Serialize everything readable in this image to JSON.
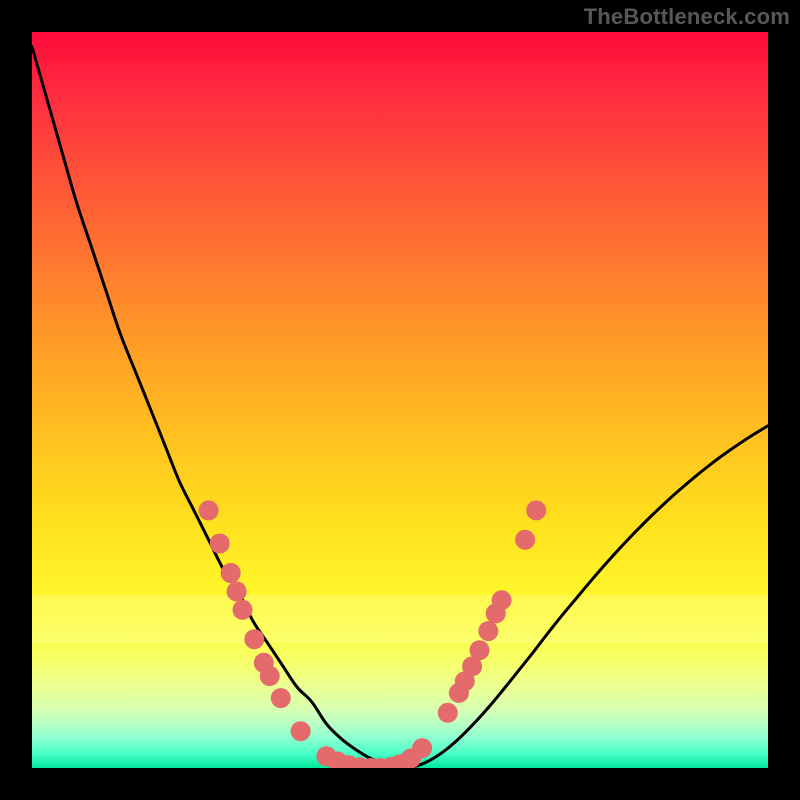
{
  "watermark": {
    "text": "TheBottleneck.com"
  },
  "colors": {
    "line": "#000000",
    "dot": "#e46a6c",
    "dot_stroke": "#d25a5c"
  },
  "chart_data": {
    "type": "line",
    "title": "",
    "xlabel": "",
    "ylabel": "",
    "xlim": [
      0,
      100
    ],
    "ylim": [
      0,
      100
    ],
    "grid": false,
    "legend": false,
    "series": [
      {
        "name": "bottleneck-curve",
        "x": [
          0,
          2,
          4,
          6,
          8,
          10,
          12,
          14,
          16,
          18,
          20,
          22,
          24,
          26,
          28,
          30,
          32,
          34,
          36,
          38,
          40,
          42,
          44,
          46,
          48,
          50,
          52,
          54,
          56,
          58,
          60,
          62,
          64,
          66,
          68,
          70,
          72,
          74,
          76,
          78,
          80,
          82,
          84,
          86,
          88,
          90,
          92,
          94,
          96,
          98,
          100
        ],
        "y": [
          98,
          91,
          84,
          77,
          71,
          65,
          59,
          54,
          49,
          44,
          39,
          35,
          31,
          27,
          24,
          20,
          17,
          14,
          11,
          9,
          6,
          4,
          2.5,
          1.3,
          0.5,
          0,
          0.2,
          1.0,
          2.3,
          4.0,
          6.0,
          8.2,
          10.6,
          13.1,
          15.6,
          18.2,
          20.7,
          23.1,
          25.5,
          27.8,
          30.0,
          32.1,
          34.1,
          36.0,
          37.8,
          39.5,
          41.1,
          42.6,
          44.0,
          45.3,
          46.5
        ]
      }
    ],
    "markers": [
      {
        "x": 24,
        "y": 35
      },
      {
        "x": 25.5,
        "y": 30.5
      },
      {
        "x": 27,
        "y": 26.5
      },
      {
        "x": 27.8,
        "y": 24
      },
      {
        "x": 28.6,
        "y": 21.5
      },
      {
        "x": 30.2,
        "y": 17.5
      },
      {
        "x": 31.5,
        "y": 14.3
      },
      {
        "x": 32.3,
        "y": 12.5
      },
      {
        "x": 33.8,
        "y": 9.5
      },
      {
        "x": 36.5,
        "y": 5
      },
      {
        "x": 40,
        "y": 1.6
      },
      {
        "x": 41.5,
        "y": 0.9
      },
      {
        "x": 43,
        "y": 0.4
      },
      {
        "x": 44.5,
        "y": 0.1
      },
      {
        "x": 46,
        "y": 0
      },
      {
        "x": 47.3,
        "y": 0
      },
      {
        "x": 48.8,
        "y": 0.15
      },
      {
        "x": 50,
        "y": 0.5
      },
      {
        "x": 51.5,
        "y": 1.3
      },
      {
        "x": 53,
        "y": 2.7
      },
      {
        "x": 56.5,
        "y": 7.5
      },
      {
        "x": 58,
        "y": 10.2
      },
      {
        "x": 58.8,
        "y": 11.8
      },
      {
        "x": 59.8,
        "y": 13.8
      },
      {
        "x": 60.8,
        "y": 16
      },
      {
        "x": 62,
        "y": 18.6
      },
      {
        "x": 63,
        "y": 21
      },
      {
        "x": 63.8,
        "y": 22.8
      },
      {
        "x": 67,
        "y": 31
      },
      {
        "x": 68.5,
        "y": 35
      }
    ]
  }
}
